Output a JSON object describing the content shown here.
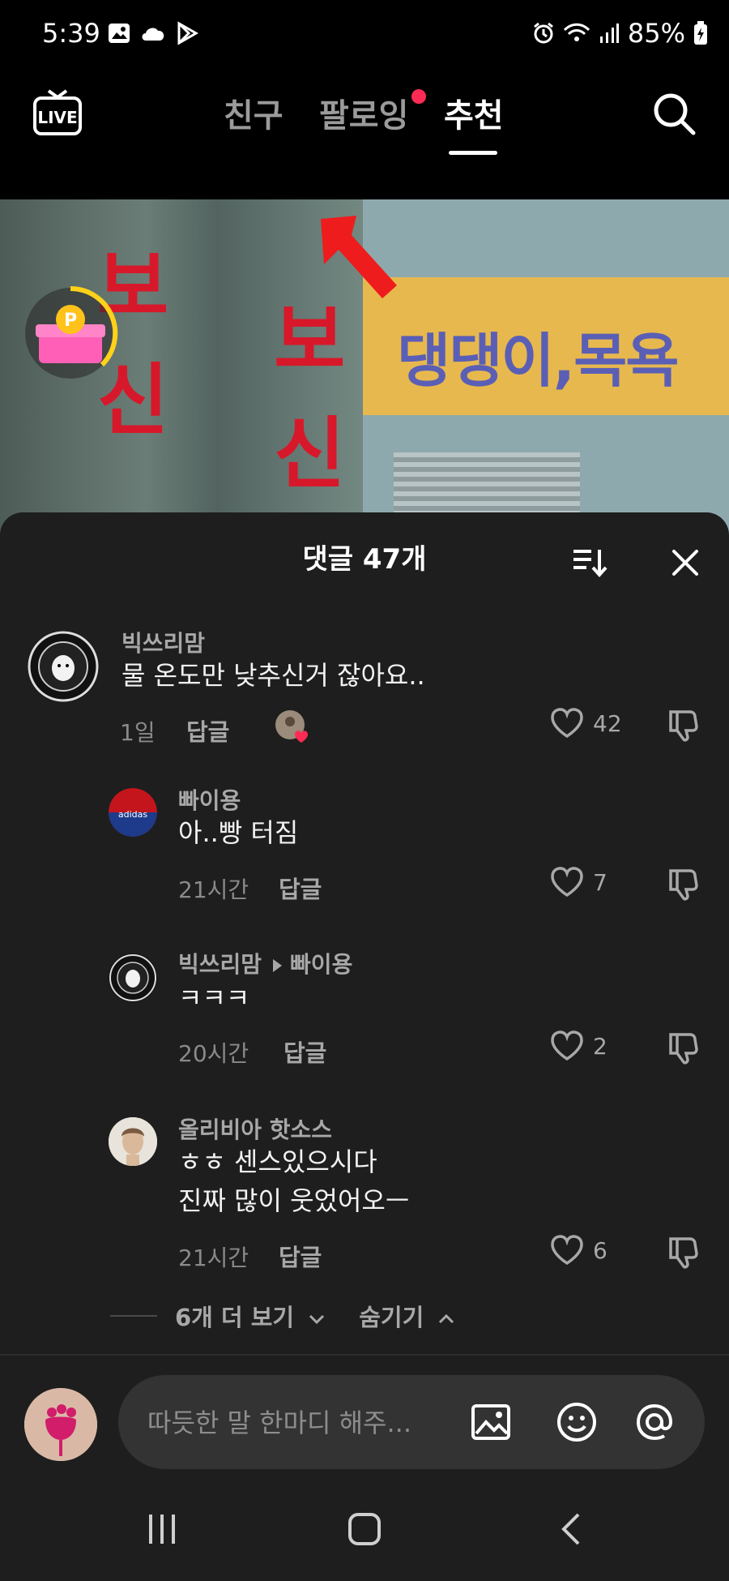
{
  "status_bar": {
    "time": "5:39",
    "battery": "85%",
    "left_icons": [
      "image-icon",
      "cloud-icon",
      "play-store-icon"
    ],
    "right_icons": [
      "alarm-icon",
      "wifi-icon",
      "signal-icon",
      "battery-icon"
    ]
  },
  "top_nav": {
    "live_label": "LIVE",
    "tabs": [
      {
        "label": "친구",
        "active": false
      },
      {
        "label": "팔로잉",
        "active": false,
        "notification_dot": true
      },
      {
        "label": "추천",
        "active": true
      }
    ]
  },
  "video": {
    "sign_text": "댕댕이,목욕",
    "chars_left": [
      "보",
      "신"
    ],
    "chars_mid": [
      "보",
      "신"
    ]
  },
  "comments_sheet": {
    "title": "댓글 47개",
    "comments": [
      {
        "user": "빅쓰리맘",
        "text": "물 온도만 낮추신거 잖아요..",
        "time": "1일",
        "reply_label": "답글",
        "likes": "42",
        "creator_liked": true
      },
      {
        "user": "빠이용",
        "text": "아..빵 터짐",
        "time": "21시간",
        "reply_label": "답글",
        "likes": "7"
      },
      {
        "user": "빅쓰리맘",
        "reply_to": "빠이용",
        "text": "ㅋㅋㅋ",
        "time": "20시간",
        "reply_label": "답글",
        "likes": "2"
      },
      {
        "user": "올리비아 핫소스",
        "text_line1": "ㅎㅎ 센스있으시다",
        "text_line2": "진짜 많이 웃었어오ㅡ",
        "time": "21시간",
        "reply_label": "답글",
        "likes": "6"
      }
    ],
    "more_label": "6개 더 보기",
    "hide_label": "숨기기"
  },
  "input": {
    "placeholder": "따듯한 말 한마디 해주..."
  },
  "colors": {
    "accent_red": "#ff2b55",
    "sheet_bg": "#1e1e1e"
  }
}
